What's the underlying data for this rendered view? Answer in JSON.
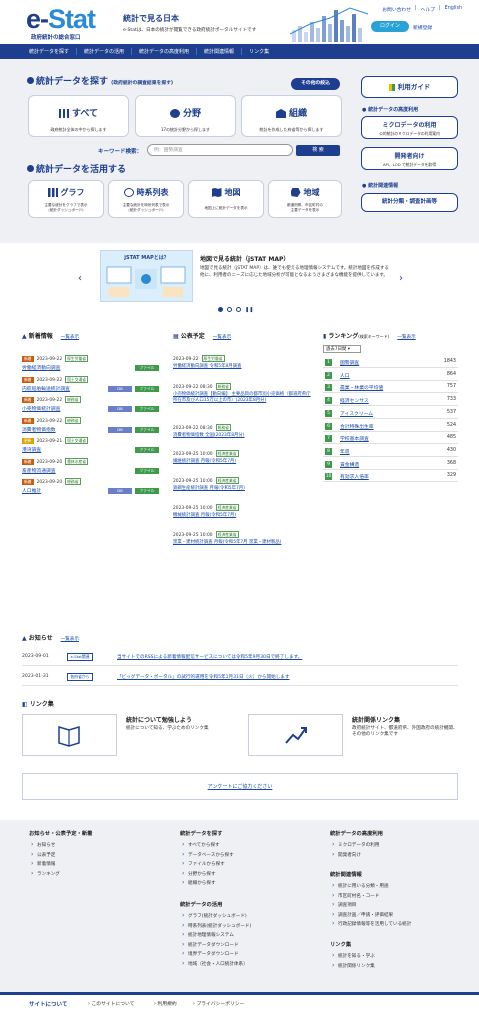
{
  "header": {
    "logo_main": "e-Stat",
    "logo_sub": "政府統計の総合窓口",
    "title": "統計で見る日本",
    "desc": "e-Statは、日本の統計が閲覧できる政府統計ポータルサイトです",
    "links": [
      "お問い合わせ",
      "ヘルプ",
      "English"
    ],
    "login": "ログイン",
    "register": "新規登録"
  },
  "nav": [
    "統計データを探す",
    "統計データの活用",
    "統計データの高度利用",
    "統計関連情報",
    "リンク集"
  ],
  "search": {
    "title": "統計データを探す",
    "subtitle": "(政府統計の調査結果を探す)",
    "other": "その他の絞込",
    "cards": [
      {
        "title": "すべて",
        "desc": "政府統計全体の中から探します"
      },
      {
        "title": "分野",
        "desc": "17の統計分野から探します"
      },
      {
        "title": "組織",
        "desc": "統計を作成した府省等から探します"
      }
    ],
    "keyword_label": "キーワード検索：",
    "keyword_placeholder": "例：国勢調査",
    "search_btn": "検 索"
  },
  "use": {
    "title": "統計データを活用する",
    "cards": [
      {
        "title": "グラフ",
        "desc": "主要な統計をグラフで表示\n(統計ダッシュボード)"
      },
      {
        "title": "時系列表",
        "desc": "主要な統計を時系列表で表示\n(統計ダッシュボード)"
      },
      {
        "title": "地図",
        "desc": "地図上に統計データを表示"
      },
      {
        "title": "地域",
        "desc": "都道府県、市区町村の\n主要データを表示"
      }
    ]
  },
  "side": {
    "guide": "利用ガイド",
    "adv_head": "統計データの高度利用",
    "micro_title": "ミクロデータの利用",
    "micro_desc": "公的統計のミクロデータの利用案内",
    "dev_title": "開発者向け",
    "dev_desc": "API、LOD で統計データを取得",
    "rel_head": "統計関連情報",
    "class_btn": "統計分類・調査計画等"
  },
  "carousel": {
    "img_label": "jSTAT MAPとは？",
    "title": "地図で見る統計（jSTAT MAP）",
    "text": "地図で見る統計（jSTAT MAP）は、誰でも使える地理情報システムです。統計地図を作成する他に、利用者のニーズに応じた地域分析が可能となるようさまざまな機能を提供しています。"
  },
  "news": {
    "title": "新着情報",
    "more": "一覧表示",
    "items": [
      {
        "tag": "新着",
        "date": "2023-09-22",
        "agency": "厚生労働省",
        "title": "労働経済動向調査",
        "chips": [
          "ファイル"
        ]
      },
      {
        "tag": "新着",
        "date": "2023-09-22",
        "agency": "国土交通省",
        "title": "内航船舶輸送統計調査",
        "chips": [
          "DB",
          "ファイル"
        ]
      },
      {
        "tag": "新着",
        "date": "2023-09-22",
        "agency": "総務省",
        "title": "小売物価統計調査",
        "chips": [
          "DB",
          "ファイル"
        ]
      },
      {
        "tag": "新着",
        "date": "2023-09-22",
        "agency": "総務省",
        "title": "消費者物価指数",
        "chips": [
          "DB",
          "ファイル"
        ]
      },
      {
        "tag": "更新",
        "date": "2023-09-21",
        "agency": "国土交通省",
        "title": "港湾調査",
        "chips": [
          "ファイル"
        ]
      },
      {
        "tag": "新着",
        "date": "2023-09-20",
        "agency": "農林水産省",
        "title": "畜産物流通調査",
        "chips": [
          "ファイル"
        ]
      },
      {
        "tag": "新着",
        "date": "2023-09-20",
        "agency": "総務省",
        "title": "人口推計",
        "chips": [
          "DB",
          "ファイル"
        ]
      }
    ]
  },
  "schedule": {
    "title": "公表予定",
    "more": "一覧表示",
    "items": [
      {
        "dt": "2023-09-22",
        "agency": "厚生労働省",
        "title": "労働経済動向調査 令和5年8月調査"
      },
      {
        "dt": "2023-09-22 08:30",
        "agency": "総務省",
        "title": "小売物価統計調査【動向編】 主要品目の都市別小売価格（都道府県庁所在市及び人口15万以上の市）(2023年8月分)"
      },
      {
        "dt": "2023-09-22 08:30",
        "agency": "総務省",
        "title": "消費者物価指数 全国(2023年8月分)"
      },
      {
        "dt": "2023-09-25 10:00",
        "agency": "経済産業省",
        "title": "繊維統計調査 月報(令和5年7月)"
      },
      {
        "dt": "2023-09-25 10:00",
        "agency": "経済産業省",
        "title": "鉄鋼生産統計調査 月報(令和5年7月)"
      },
      {
        "dt": "2023-09-25 10:00",
        "agency": "経済産業省",
        "title": "機械統計調査 月報(令和5年7月)"
      },
      {
        "dt": "2023-09-25 10:00",
        "agency": "経済産業省",
        "title": "窯業・建材統計調査 月報(令和5年7月 窯業・建材製品)"
      }
    ]
  },
  "ranking": {
    "title": "ランキング",
    "subtitle": "(検索キーワード)",
    "more": "一覧表示",
    "period": "過去7日間",
    "items": [
      {
        "name": "国勢調査",
        "count": "1843"
      },
      {
        "name": "人口",
        "count": "864"
      },
      {
        "name": "農業・林業の平均値",
        "count": "757"
      },
      {
        "name": "経済センサス",
        "count": "733"
      },
      {
        "name": "アイスクリーム",
        "count": "537"
      },
      {
        "name": "合計特殊出生率",
        "count": "524"
      },
      {
        "name": "学校基本調査",
        "count": "485"
      },
      {
        "name": "年収",
        "count": "430"
      },
      {
        "name": "賃金構造",
        "count": "368"
      },
      {
        "name": "有効求人倍率",
        "count": "329"
      }
    ]
  },
  "notice": {
    "title": "お知らせ",
    "more": "一覧表示",
    "items": [
      {
        "date": "2023-09-01",
        "tag": "e-Stat関連",
        "text": "当サイトでのRSSによる新着情報配信サービスについては令和5年9月30日で終了します。"
      },
      {
        "date": "2023-01-31",
        "tag": "各府省から",
        "text": "「ビッグデータ・ポータル」の試行的運用を令和5年1月31日（火）から開始します"
      }
    ]
  },
  "links": {
    "title": "リンク集",
    "items": [
      {
        "title": "統計について勉強しよう",
        "desc": "統計について知る、学ぶためのリンク集"
      },
      {
        "title": "統計関係リンク集",
        "desc": "政府統計サイト、都道府県、外国政府の統計機関、その他のリンク集です"
      }
    ]
  },
  "survey": "アンケートにご協力ください",
  "footer": {
    "cols": [
      {
        "head": "お知らせ・公表予定・新着",
        "items": [
          "お知らせ",
          "公表予定",
          "新着情報",
          "ランキング"
        ]
      },
      {
        "head": "統計データを探す",
        "items": [
          "すべてから探す",
          "データベースから探す",
          "ファイルから探す",
          "分野から探す",
          "組織から探す"
        ]
      },
      {
        "head": "統計データの高度利用",
        "items": [
          "ミクロデータの利用",
          "開発者向け"
        ]
      },
      {
        "head": "統計データの活用",
        "items": [
          "グラフ(統計ダッシュボード)",
          "時系列表(統計ダッシュボード)",
          "統計地理情報システム",
          "統計データダウンロード",
          "境界データダウンロード",
          "地域（社会・人口統計体系）"
        ]
      },
      {
        "head": "統計関連情報",
        "items": [
          "統計に用いる分類・用語",
          "市区町村名・コード",
          "調査項目",
          "調査計画／申請・評価結果",
          "行政記録情報等を活用している統計"
        ]
      },
      {
        "head": "リンク集",
        "items": [
          "統計を知る・学ぶ",
          "統計関係リンク集"
        ]
      }
    ]
  },
  "bottom": {
    "head": "サイトについて",
    "items": [
      "このサイトについて",
      "利用規約",
      "プライバシーポリシー"
    ]
  }
}
